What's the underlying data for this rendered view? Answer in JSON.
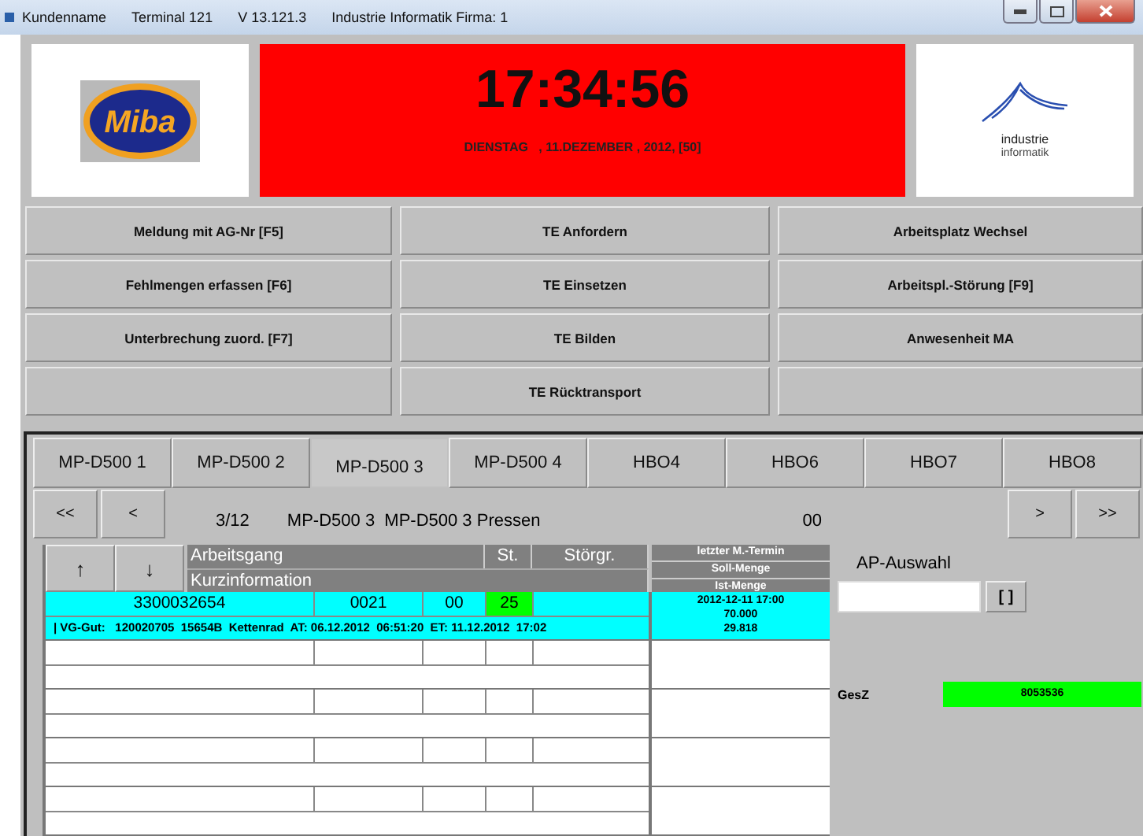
{
  "title_bar": {
    "items": [
      "Kundenname",
      "Terminal 121",
      "V 13.121.3",
      "Industrie Informatik Firma: 1"
    ]
  },
  "header": {
    "left_logo": "Miba",
    "time": "17:34:56",
    "date": "DIENSTAG   , 11.DEZEMBER , 2012, [50]",
    "right_logo": [
      "industrie",
      "informatik"
    ]
  },
  "function_buttons": [
    {
      "kind": "labeled",
      "label": "Meldung mit AG-Nr [F5]"
    },
    {
      "kind": "labeled",
      "label": "TE Anfordern"
    },
    {
      "kind": "labeled",
      "label": "Arbeitsplatz Wechsel"
    },
    {
      "kind": "labeled",
      "label": "Fehlmengen erfassen [F6]"
    },
    {
      "kind": "labeled",
      "label": "TE Einsetzen"
    },
    {
      "kind": "labeled",
      "label": "Arbeitspl.-Störung [F9]"
    },
    {
      "kind": "labeled",
      "label": "Unterbrechung zuord. [F7]"
    },
    {
      "kind": "labeled",
      "label": "TE Bilden"
    },
    {
      "kind": "labeled",
      "label": "Anwesenheit MA"
    },
    {
      "kind": "blank"
    },
    {
      "kind": "labeled",
      "label": "TE Rücktransport"
    },
    {
      "kind": "blank"
    }
  ],
  "tabs": [
    {
      "label": "MP-D500 1",
      "selected": false
    },
    {
      "label": "MP-D500 2",
      "selected": false
    },
    {
      "label": "MP-D500 3",
      "selected": true
    },
    {
      "label": "MP-D500 4",
      "selected": false
    },
    {
      "label": "HBO4",
      "selected": false
    },
    {
      "label": "HBO6",
      "selected": false
    },
    {
      "label": "HBO7",
      "selected": false
    },
    {
      "label": "HBO8",
      "selected": false
    }
  ],
  "nav": {
    "first": "<<",
    "prev": "<",
    "position": "3/12",
    "workplace": "MP-D500 3  MP-D500 3 Pressen",
    "code": "00",
    "next": ">",
    "last": ">>"
  },
  "table": {
    "up": "↑",
    "down": "↓",
    "columns": [
      "Arbeitsgang",
      "St.",
      "Störgr."
    ],
    "subheader": "Kurzinformation",
    "side_columns": [
      "letzter M.-Termin",
      "Soll-Menge",
      "Ist-Menge"
    ],
    "rows": [
      {
        "selected": true,
        "cells": [
          "3300032654",
          "0021",
          "00",
          "25"
        ],
        "color": "#00ff00",
        "info": "| VG-Gut:   120020705  15654B  Kettenrad  AT: 06.12.2012  06:51:20  ET: 11.12.2012  17:02",
        "side": [
          "2012-12-11 17:00",
          "70.000",
          "29.818"
        ]
      },
      {
        "selected": false
      },
      {
        "selected": false
      },
      {
        "selected": false
      },
      {
        "selected": false
      }
    ]
  },
  "ap_panel": {
    "label": "AP-Auswahl",
    "button": "[ ]",
    "gesz_label": "GesZ",
    "gesz_value": "8053536"
  }
}
